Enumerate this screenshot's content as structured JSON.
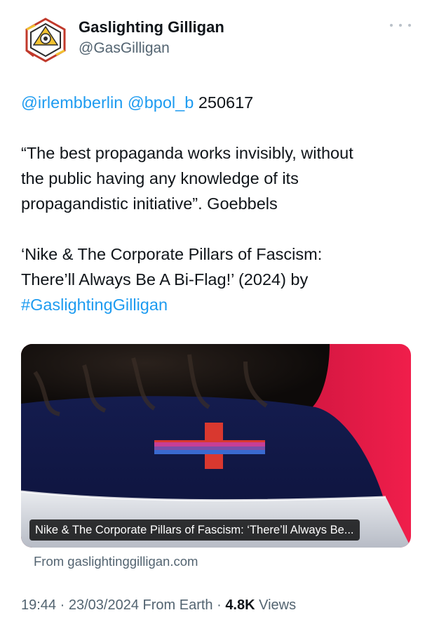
{
  "author": {
    "display_name": "Gaslighting Gilligan",
    "handle": "@GasGilligan",
    "avatar_icon": "geometric-emblem-icon"
  },
  "more_icon": "more-dots-icon",
  "tweet": {
    "mention_1": "@irlembberlin",
    "mention_2": "@bpol_b",
    "ref_number": "250617",
    "quote_line_1": "“The best propaganda works invisibly, without",
    "quote_line_2": "the public having any knowledge of its",
    "quote_line_3": "propagandistic initiative”. Goebbels",
    "title_line_1": "‘Nike & The Corporate Pillars of Fascism:",
    "title_line_2": "There’ll Always Be A Bi-Flag!’ (2024) by",
    "hashtag": "#GaslightingGilligan"
  },
  "link_card": {
    "caption": "Nike & The Corporate Pillars of Fascism: ‘There’ll Always Be...",
    "source": "From gaslightinggilligan.com"
  },
  "meta": {
    "time": "19:44",
    "separator_1": " · ",
    "date": "23/03/2024",
    "location": " From Earth",
    "separator_2": " · ",
    "views_count": "4.8K",
    "views_label": " Views"
  },
  "colors": {
    "link": "#1d9bf0",
    "secondary_text": "#536471",
    "primary_text": "#0f1419"
  }
}
